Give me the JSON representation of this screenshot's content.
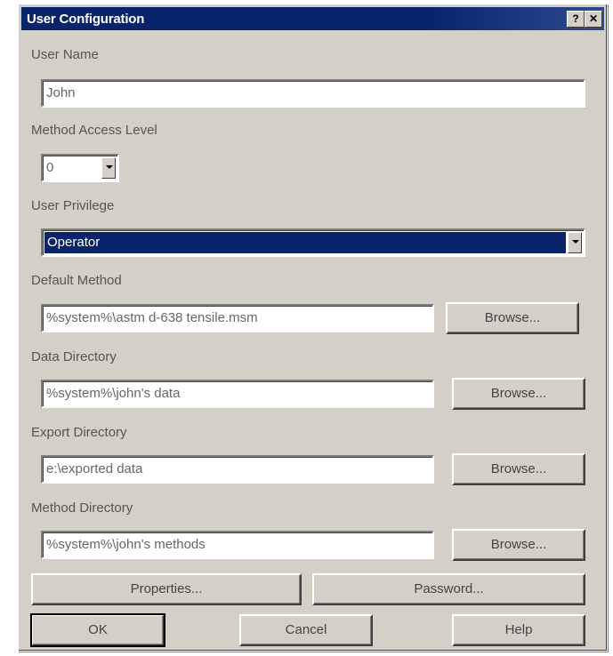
{
  "window": {
    "title": "User Configuration",
    "help_glyph": "?",
    "close_glyph": "✕"
  },
  "user_name": {
    "label": "User Name",
    "value": "John"
  },
  "method_access_level": {
    "label": "Method Access Level",
    "value": "0"
  },
  "user_privilege": {
    "label": "User Privilege",
    "value": "Operator",
    "selected_color": "#0a246a"
  },
  "default_method": {
    "label": "Default Method",
    "value": "%system%\\astm d-638 tensile.msm",
    "browse": "Browse..."
  },
  "data_directory": {
    "label": "Data Directory",
    "value": "%system%\\john's data",
    "browse": "Browse..."
  },
  "export_directory": {
    "label": "Export Directory",
    "value": "e:\\exported data",
    "browse": "Browse..."
  },
  "method_directory": {
    "label": "Method Directory",
    "value": "%system%\\john's methods",
    "browse": "Browse..."
  },
  "buttons": {
    "properties": "Properties...",
    "password": "Password...",
    "ok": "OK",
    "cancel": "Cancel",
    "help": "Help"
  }
}
